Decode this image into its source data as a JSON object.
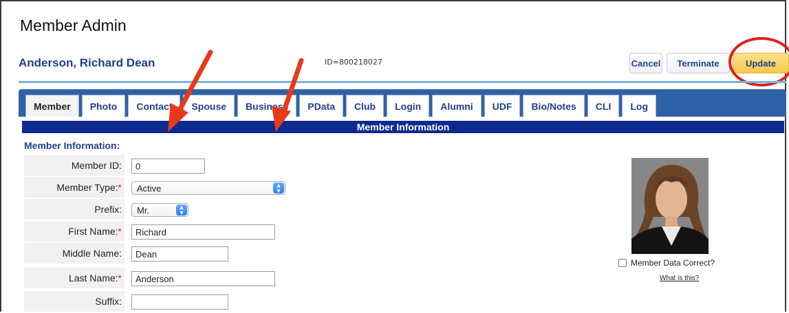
{
  "app": {
    "title": "Member Admin"
  },
  "member": {
    "name": "Anderson, Richard Dean",
    "id_text": "ID=800218027"
  },
  "actions": {
    "cancel": "Cancel",
    "terminate": "Terminate",
    "update": "Update"
  },
  "tabs": [
    {
      "label": "Member",
      "active": true
    },
    {
      "label": "Photo"
    },
    {
      "label": "Contact"
    },
    {
      "label": "Spouse"
    },
    {
      "label": "Business"
    },
    {
      "label": "PData"
    },
    {
      "label": "Club"
    },
    {
      "label": "Login"
    },
    {
      "label": "Alumni"
    },
    {
      "label": "UDF"
    },
    {
      "label": "Bio/Notes"
    },
    {
      "label": "CLI"
    },
    {
      "label": "Log"
    }
  ],
  "info_bar": "Member Information",
  "section": {
    "title": "Member Information:"
  },
  "fields": {
    "member_id": {
      "label": "Member ID:",
      "value": "0"
    },
    "member_type": {
      "label": "Member Type:",
      "required": "*",
      "value": "Active"
    },
    "prefix": {
      "label": "Prefix:",
      "value": "Mr."
    },
    "first_name": {
      "label": "First Name:",
      "required": "*",
      "value": "Richard"
    },
    "middle_name": {
      "label": "Middle Name:",
      "value": "Dean"
    },
    "last_name": {
      "label": "Last Name:",
      "required": "*",
      "value": "Anderson"
    },
    "suffix": {
      "label": "Suffix:",
      "value": ""
    }
  },
  "photo": {
    "correct_label": "Member Data Correct?",
    "what_link": "What is this?"
  },
  "colors": {
    "brand_blue": "#1f3f8c",
    "tab_bar": "#2d62a6",
    "info_bar": "#0d2a8f",
    "update_button": "#f7c84a",
    "annotation_red": "#d9231c"
  }
}
